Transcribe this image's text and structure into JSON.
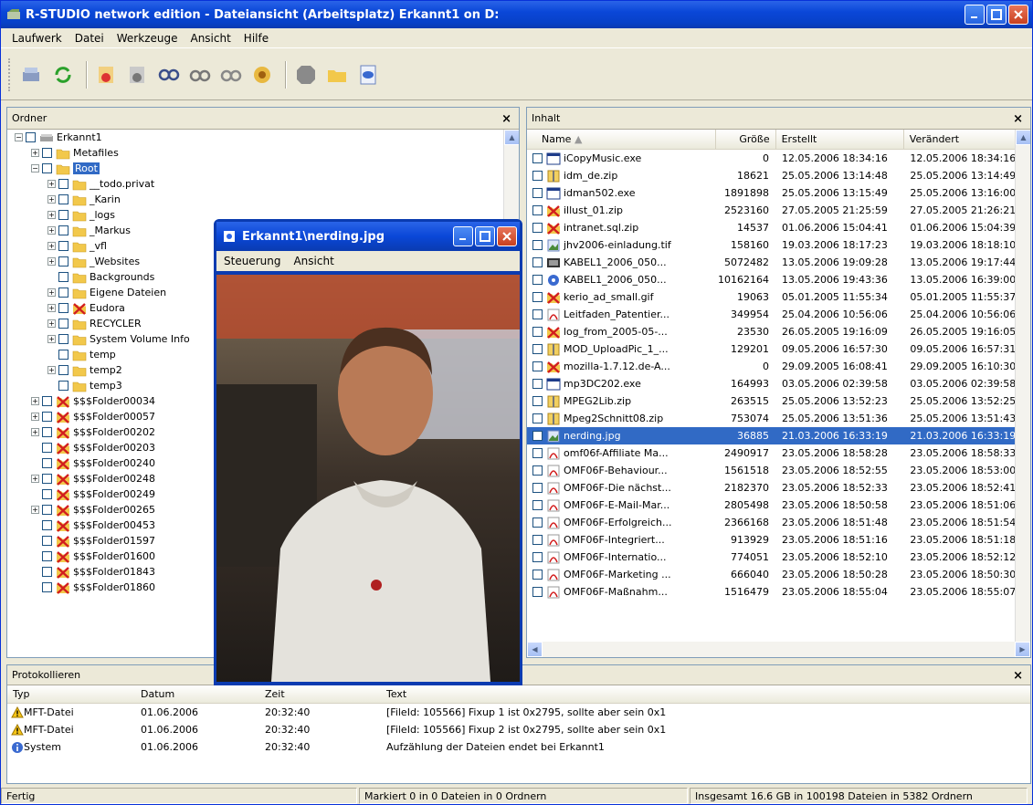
{
  "window": {
    "title": "R-STUDIO network edition - Dateiansicht (Arbeitsplatz) Erkannt1 on D:"
  },
  "menu": [
    "Laufwerk",
    "Datei",
    "Werkzeuge",
    "Ansicht",
    "Hilfe"
  ],
  "toolbar_icons": [
    "drive-icon",
    "refresh-icon",
    "open-drive-image-icon",
    "create-image-icon",
    "find-icon",
    "scan-icon",
    "scan-region-icon",
    "recover-icon",
    "stop-icon",
    "open-folder-icon",
    "preview-icon"
  ],
  "left_pane": {
    "title": "Ordner",
    "close": "×",
    "tree": [
      {
        "label": "Erkannt1",
        "icon": "drive"
      },
      {
        "label": "Metafiles",
        "icon": "folder"
      },
      {
        "label": "Root",
        "icon": "folder",
        "selected": true
      },
      {
        "label": "__todo.privat",
        "icon": "folder"
      },
      {
        "label": "_Karin",
        "icon": "folder"
      },
      {
        "label": "_logs",
        "icon": "folder"
      },
      {
        "label": "_Markus",
        "icon": "folder"
      },
      {
        "label": "_vfl",
        "icon": "folder"
      },
      {
        "label": "_Websites",
        "icon": "folder"
      },
      {
        "label": "Backgrounds",
        "icon": "folder"
      },
      {
        "label": "Eigene Dateien",
        "icon": "folder"
      },
      {
        "label": "Eudora",
        "icon": "deleted"
      },
      {
        "label": "RECYCLER",
        "icon": "folder"
      },
      {
        "label": "System Volume Info",
        "icon": "folder"
      },
      {
        "label": "temp",
        "icon": "folder"
      },
      {
        "label": "temp2",
        "icon": "folder"
      },
      {
        "label": "temp3",
        "icon": "folder"
      },
      {
        "label": "$$$Folder00034",
        "icon": "deleted"
      },
      {
        "label": "$$$Folder00057",
        "icon": "deleted"
      },
      {
        "label": "$$$Folder00202",
        "icon": "deleted"
      },
      {
        "label": "$$$Folder00203",
        "icon": "deleted"
      },
      {
        "label": "$$$Folder00240",
        "icon": "deleted"
      },
      {
        "label": "$$$Folder00248",
        "icon": "deleted"
      },
      {
        "label": "$$$Folder00249",
        "icon": "deleted"
      },
      {
        "label": "$$$Folder00265",
        "icon": "deleted"
      },
      {
        "label": "$$$Folder00453",
        "icon": "deleted"
      },
      {
        "label": "$$$Folder01597",
        "icon": "deleted"
      },
      {
        "label": "$$$Folder01600",
        "icon": "deleted"
      },
      {
        "label": "$$$Folder01843",
        "icon": "deleted"
      },
      {
        "label": "$$$Folder01860",
        "icon": "deleted"
      }
    ]
  },
  "right_pane": {
    "title": "Inhalt",
    "close": "×",
    "columns": [
      "Name",
      "Größe",
      "Erstellt",
      "Verändert"
    ],
    "files": [
      {
        "name": "iCopyMusic.exe",
        "icon": "exe",
        "size": "0",
        "created": "12.05.2006 18:34:16",
        "modified": "12.05.2006 18:34:16"
      },
      {
        "name": "idm_de.zip",
        "icon": "zip",
        "size": "18621",
        "created": "25.05.2006 13:14:48",
        "modified": "25.05.2006 13:14:49"
      },
      {
        "name": "idman502.exe",
        "icon": "exe",
        "size": "1891898",
        "created": "25.05.2006 13:15:49",
        "modified": "25.05.2006 13:16:00"
      },
      {
        "name": "illust_01.zip",
        "icon": "deleted",
        "size": "2523160",
        "created": "27.05.2005 21:25:59",
        "modified": "27.05.2005 21:26:21"
      },
      {
        "name": "intranet.sql.zip",
        "icon": "deleted",
        "size": "14537",
        "created": "01.06.2006 15:04:41",
        "modified": "01.06.2006 15:04:39"
      },
      {
        "name": "jhv2006-einladung.tif",
        "icon": "image",
        "size": "158160",
        "created": "19.03.2006 18:17:23",
        "modified": "19.03.2006 18:18:10"
      },
      {
        "name": "KABEL1_2006_050...",
        "icon": "video",
        "size": "5072482",
        "created": "13.05.2006 19:09:28",
        "modified": "13.05.2006 19:17:44"
      },
      {
        "name": "KABEL1_2006_050...",
        "icon": "media",
        "size": "10162164",
        "created": "13.05.2006 19:43:36",
        "modified": "13.05.2006 16:39:00"
      },
      {
        "name": "kerio_ad_small.gif",
        "icon": "deleted",
        "size": "19063",
        "created": "05.01.2005 11:55:34",
        "modified": "05.01.2005 11:55:37"
      },
      {
        "name": "Leitfaden_Patentier...",
        "icon": "pdf",
        "size": "349954",
        "created": "25.04.2006 10:56:06",
        "modified": "25.04.2006 10:56:06"
      },
      {
        "name": "log_from_2005-05-...",
        "icon": "deleted",
        "size": "23530",
        "created": "26.05.2005 19:16:09",
        "modified": "26.05.2005 19:16:05"
      },
      {
        "name": "MOD_UploadPic_1_...",
        "icon": "zip",
        "size": "129201",
        "created": "09.05.2006 16:57:30",
        "modified": "09.05.2006 16:57:31"
      },
      {
        "name": "mozilla-1.7.12.de-A...",
        "icon": "deleted",
        "size": "0",
        "created": "29.09.2005 16:08:41",
        "modified": "29.09.2005 16:10:30"
      },
      {
        "name": "mp3DC202.exe",
        "icon": "exe",
        "size": "164993",
        "created": "03.05.2006 02:39:58",
        "modified": "03.05.2006 02:39:58"
      },
      {
        "name": "MPEG2Lib.zip",
        "icon": "zip",
        "size": "263515",
        "created": "25.05.2006 13:52:23",
        "modified": "25.05.2006 13:52:25"
      },
      {
        "name": "Mpeg2Schnitt08.zip",
        "icon": "zip",
        "size": "753074",
        "created": "25.05.2006 13:51:36",
        "modified": "25.05.2006 13:51:43"
      },
      {
        "name": "nerding.jpg",
        "icon": "image",
        "size": "36885",
        "created": "21.03.2006 16:33:19",
        "modified": "21.03.2006 16:33:19",
        "selected": true
      },
      {
        "name": "omf06f-Affiliate Ma...",
        "icon": "pdf",
        "size": "2490917",
        "created": "23.05.2006 18:58:28",
        "modified": "23.05.2006 18:58:33"
      },
      {
        "name": "OMF06F-Behaviour...",
        "icon": "pdf",
        "size": "1561518",
        "created": "23.05.2006 18:52:55",
        "modified": "23.05.2006 18:53:00"
      },
      {
        "name": "OMF06F-Die nächst...",
        "icon": "pdf",
        "size": "2182370",
        "created": "23.05.2006 18:52:33",
        "modified": "23.05.2006 18:52:41"
      },
      {
        "name": "OMF06F-E-Mail-Mar...",
        "icon": "pdf",
        "size": "2805498",
        "created": "23.05.2006 18:50:58",
        "modified": "23.05.2006 18:51:06"
      },
      {
        "name": "OMF06F-Erfolgreich...",
        "icon": "pdf",
        "size": "2366168",
        "created": "23.05.2006 18:51:48",
        "modified": "23.05.2006 18:51:54"
      },
      {
        "name": "OMF06F-Integriert...",
        "icon": "pdf",
        "size": "913929",
        "created": "23.05.2006 18:51:16",
        "modified": "23.05.2006 18:51:18"
      },
      {
        "name": "OMF06F-Internatio...",
        "icon": "pdf",
        "size": "774051",
        "created": "23.05.2006 18:52:10",
        "modified": "23.05.2006 18:52:12"
      },
      {
        "name": "OMF06F-Marketing ...",
        "icon": "pdf",
        "size": "666040",
        "created": "23.05.2006 18:50:28",
        "modified": "23.05.2006 18:50:30"
      },
      {
        "name": "OMF06F-Maßnahm...",
        "icon": "pdf",
        "size": "1516479",
        "created": "23.05.2006 18:55:04",
        "modified": "23.05.2006 18:55:07"
      }
    ]
  },
  "log": {
    "title": "Protokollieren",
    "close": "×",
    "columns": [
      "Typ",
      "Datum",
      "Zeit",
      "Text"
    ],
    "rows": [
      {
        "type": "MFT-Datei",
        "icon": "warning",
        "date": "01.06.2006",
        "time": "20:32:40",
        "text": "[FileId: 105566] Fixup 1 ist 0x2795, sollte aber sein 0x1"
      },
      {
        "type": "MFT-Datei",
        "icon": "warning",
        "date": "01.06.2006",
        "time": "20:32:40",
        "text": "[FileId: 105566] Fixup 2 ist 0x2795, sollte aber sein 0x1"
      },
      {
        "type": "System",
        "icon": "info",
        "date": "01.06.2006",
        "time": "20:32:40",
        "text": "Aufzählung der Dateien endet bei Erkannt1"
      }
    ]
  },
  "status": {
    "left": "Fertig",
    "middle": "Markiert 0 in 0 Dateien in 0 Ordnern",
    "right": "Insgesamt 16.6 GB in 100198 Dateien in 5382 Ordnern"
  },
  "preview": {
    "title": "Erkannt1\\nerding.jpg",
    "menu": [
      "Steuerung",
      "Ansicht"
    ]
  },
  "colors": {
    "accent": "#316AC5",
    "title_blue": "#0A47D8",
    "face": "#ECE9D8"
  }
}
